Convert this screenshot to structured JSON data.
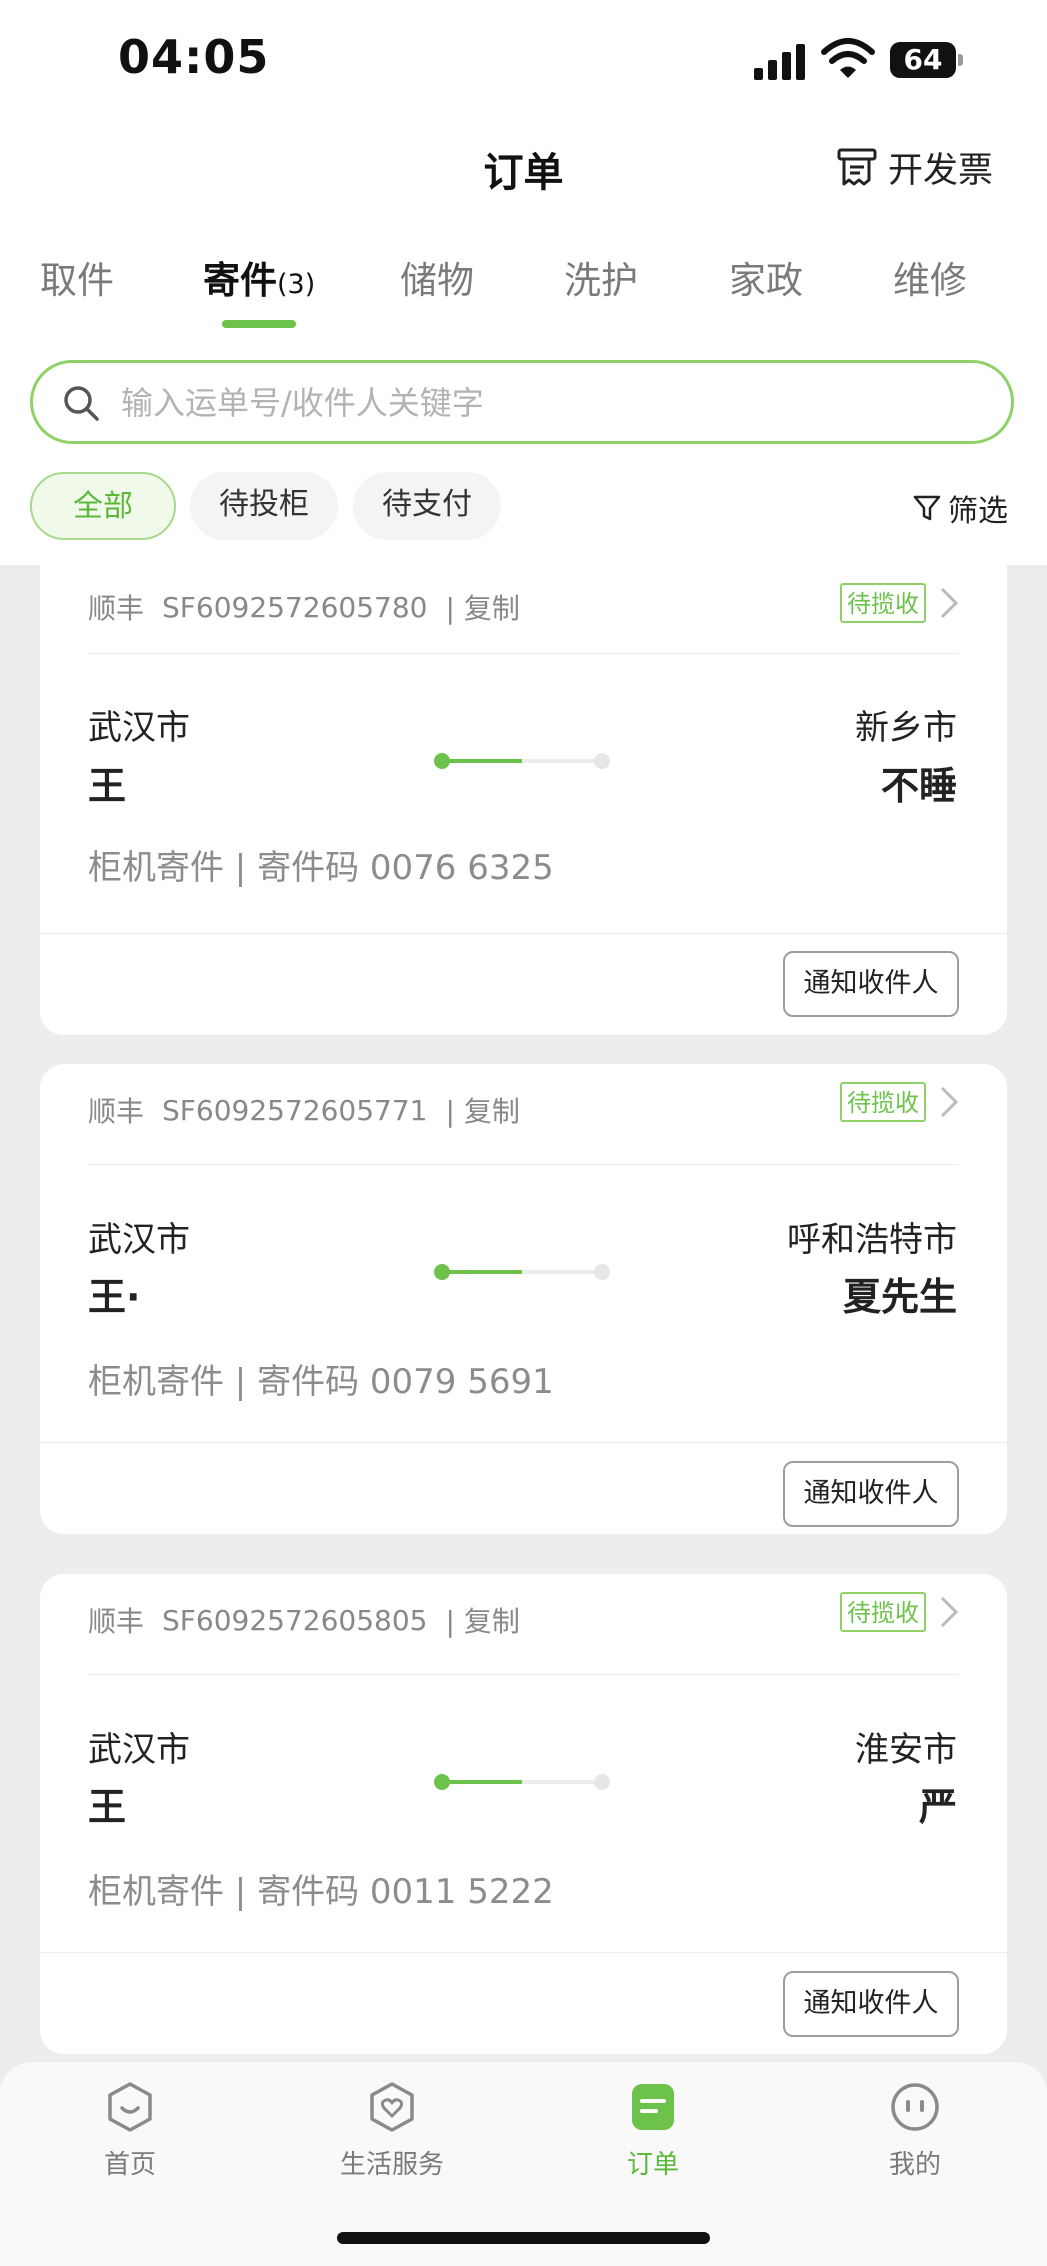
{
  "status_bar": {
    "time": "04:05",
    "battery": "64"
  },
  "header": {
    "title": "订单",
    "invoice_label": "开发票"
  },
  "tabs": [
    {
      "label": "取件"
    },
    {
      "label": "寄件",
      "count": "(3)"
    },
    {
      "label": "储物"
    },
    {
      "label": "洗护"
    },
    {
      "label": "家政"
    },
    {
      "label": "维修"
    }
  ],
  "search": {
    "placeholder": "输入运单号/收件人关键字"
  },
  "filters": {
    "chips": [
      "全部",
      "待投柜",
      "待支付"
    ],
    "filter_label": "筛选"
  },
  "orders": [
    {
      "carrier": "顺丰",
      "tracking": "SF6092572605780",
      "copy": "| 复制",
      "status": "待揽收",
      "from_city": "武汉市",
      "from_name": "王",
      "to_city": "新乡市",
      "to_name": "不睡",
      "meta": "柜机寄件 | 寄件码 0076 6325",
      "action": "通知收件人"
    },
    {
      "carrier": "顺丰",
      "tracking": "SF6092572605771",
      "copy": "| 复制",
      "status": "待揽收",
      "from_city": "武汉市",
      "from_name": "王·",
      "to_city": "呼和浩特市",
      "to_name": "夏先生",
      "meta": "柜机寄件 | 寄件码 0079 5691",
      "action": "通知收件人"
    },
    {
      "carrier": "顺丰",
      "tracking": "SF6092572605805",
      "copy": "| 复制",
      "status": "待揽收",
      "from_city": "武汉市",
      "from_name": "王",
      "to_city": "淮安市",
      "to_name": "严",
      "meta": "柜机寄件 | 寄件码 0011 5222",
      "action": "通知收件人"
    }
  ],
  "bottom_nav": [
    {
      "label": "首页"
    },
    {
      "label": "生活服务"
    },
    {
      "label": "订单"
    },
    {
      "label": "我的"
    }
  ],
  "colors": {
    "accent": "#6cc24a",
    "accent_light": "#8fd168"
  }
}
